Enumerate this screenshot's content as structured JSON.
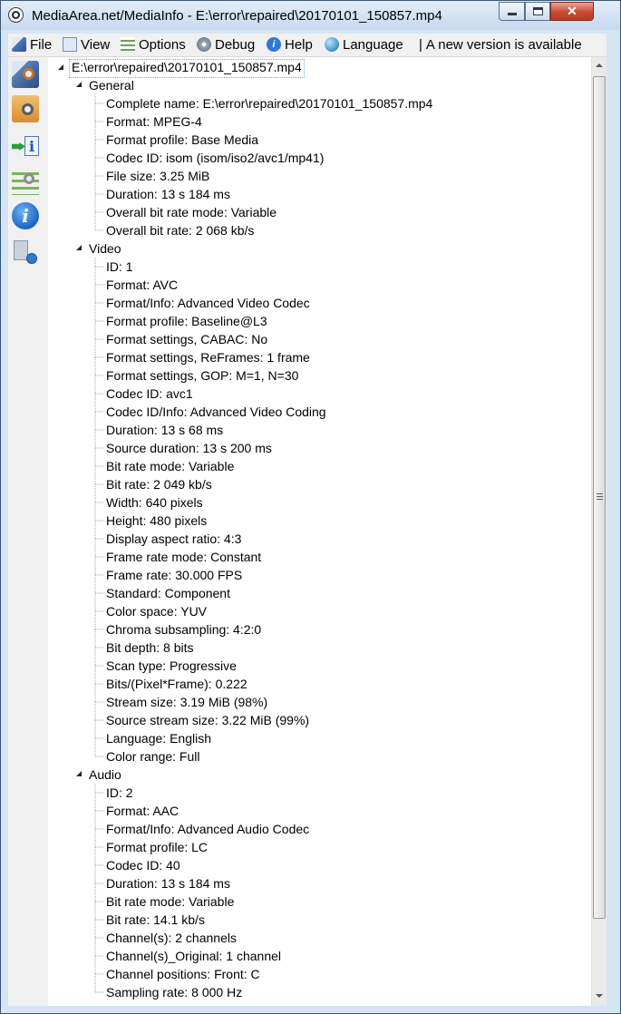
{
  "window": {
    "title": "MediaArea.net/MediaInfo - E:\\error\\repaired\\20170101_150857.mp4",
    "close_glyph": "✕"
  },
  "menu": {
    "items": [
      {
        "label": "File",
        "icon": "file-icon"
      },
      {
        "label": "View",
        "icon": "view-icon"
      },
      {
        "label": "Options",
        "icon": "options-icon"
      },
      {
        "label": "Debug",
        "icon": "debug-icon"
      },
      {
        "label": "Help",
        "icon": "help-icon"
      },
      {
        "label": "Language",
        "icon": "language-icon"
      }
    ],
    "separator": "|",
    "notice": "A new version is available"
  },
  "sidebar": {
    "icons": [
      "open-file-icon",
      "open-folder-icon",
      "export-icon",
      "preferences-icon",
      "about-icon",
      "web-knowledge-icon"
    ],
    "about_glyph": "i"
  },
  "tree": {
    "root": "E:\\error\\repaired\\20170101_150857.mp4",
    "sections": [
      {
        "name": "General",
        "items": [
          "Complete name: E:\\error\\repaired\\20170101_150857.mp4",
          "Format: MPEG-4",
          "Format profile: Base Media",
          "Codec ID: isom (isom/iso2/avc1/mp41)",
          "File size: 3.25 MiB",
          "Duration: 13 s 184 ms",
          "Overall bit rate mode: Variable",
          "Overall bit rate: 2 068 kb/s"
        ]
      },
      {
        "name": "Video",
        "items": [
          "ID: 1",
          "Format: AVC",
          "Format/Info: Advanced Video Codec",
          "Format profile: Baseline@L3",
          "Format settings, CABAC: No",
          "Format settings, ReFrames: 1 frame",
          "Format settings, GOP: M=1, N=30",
          "Codec ID: avc1",
          "Codec ID/Info: Advanced Video Coding",
          "Duration: 13 s 68 ms",
          "Source duration: 13 s 200 ms",
          "Bit rate mode: Variable",
          "Bit rate: 2 049 kb/s",
          "Width: 640 pixels",
          "Height: 480 pixels",
          "Display aspect ratio: 4:3",
          "Frame rate mode: Constant",
          "Frame rate: 30.000 FPS",
          "Standard: Component",
          "Color space: YUV",
          "Chroma subsampling: 4:2:0",
          "Bit depth: 8 bits",
          "Scan type: Progressive",
          "Bits/(Pixel*Frame): 0.222",
          "Stream size: 3.19 MiB (98%)",
          "Source stream size: 3.22 MiB (99%)",
          "Language: English",
          "Color range: Full"
        ]
      },
      {
        "name": "Audio",
        "items": [
          "ID: 2",
          "Format: AAC",
          "Format/Info: Advanced Audio Codec",
          "Format profile: LC",
          "Codec ID: 40",
          "Duration: 13 s 184 ms",
          "Bit rate mode: Variable",
          "Bit rate: 14.1 kb/s",
          "Channel(s): 2 channels",
          "Channel(s)_Original: 1 channel",
          "Channel positions: Front: C",
          "Sampling rate: 8 000 Hz"
        ]
      }
    ]
  }
}
